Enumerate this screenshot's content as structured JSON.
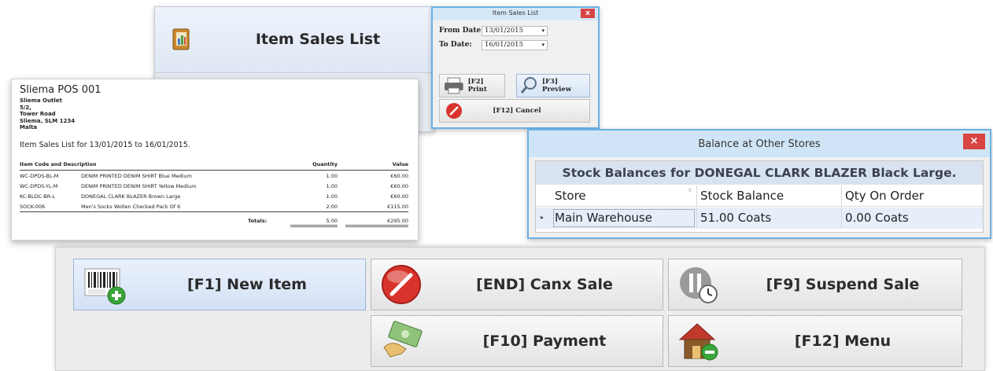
{
  "item_sales_panel": {
    "title": "Item Sales List"
  },
  "date_dialog": {
    "title": "Item Sales List",
    "close": "x",
    "from_label": "From Date:",
    "from_value": "13/01/2015",
    "to_label": "To Date:",
    "to_value": "16/01/2015",
    "dropdown": "▾",
    "print_label": "[F2] Print",
    "preview_label": "[F3] Preview",
    "cancel_label": "[F12] Cancel"
  },
  "report": {
    "store": "Sliema POS 001",
    "address": [
      "Sliema Outlet",
      "5/2,",
      "Tower Road",
      "Sliema, SLM 1234",
      "Malta"
    ],
    "heading": "Item Sales List for 13/01/2015 to 16/01/2015.",
    "columns": {
      "code": "Item Code and Description",
      "quantity": "Quantity",
      "value": "Value"
    },
    "rows": [
      {
        "code": "WC-DPDS-BL-M",
        "desc": "DENIM PRINTED DENIM SHIRT Blue Medium",
        "qty": "1.00",
        "value": "€60.00"
      },
      {
        "code": "WC-DPDS-YL-M",
        "desc": "DENIM PRINTED DENIM SHIRT Yellow Medium",
        "qty": "1.00",
        "value": "€60.00"
      },
      {
        "code": "KC-BLDC-BR-L",
        "desc": "DONEGAL CLARK BLAZER Brown Large",
        "qty": "1.00",
        "value": "€60.00"
      },
      {
        "code": "SOCK-006",
        "desc": "Men's Socks Wollen Checked Pack Of 6",
        "qty": "2.00",
        "value": "€115.00"
      }
    ],
    "totals_label": "Totals:",
    "total_qty": "5.00",
    "total_value": "€295.00"
  },
  "balance_window": {
    "title": "Balance at Other Stores",
    "close": "×",
    "caption": "Stock Balances for DONEGAL CLARK BLAZER Black Large.",
    "columns": {
      "store": "Store",
      "balance": "Stock Balance",
      "on_order": "Qty On Order"
    },
    "rows": [
      {
        "store": "Main Warehouse",
        "balance": "51.00 Coats",
        "on_order": "0.00 Coats"
      }
    ]
  },
  "buttons": {
    "new_item": "[F1] New Item",
    "canx_sale": "[END] Canx Sale",
    "suspend_sale": "[F9] Suspend Sale",
    "payment": "[F10] Payment",
    "menu": "[F12]  Menu"
  },
  "colors": {
    "accent": "#6cb0e5",
    "close_red": "#d94444",
    "selected_row": "#e6eefa"
  }
}
